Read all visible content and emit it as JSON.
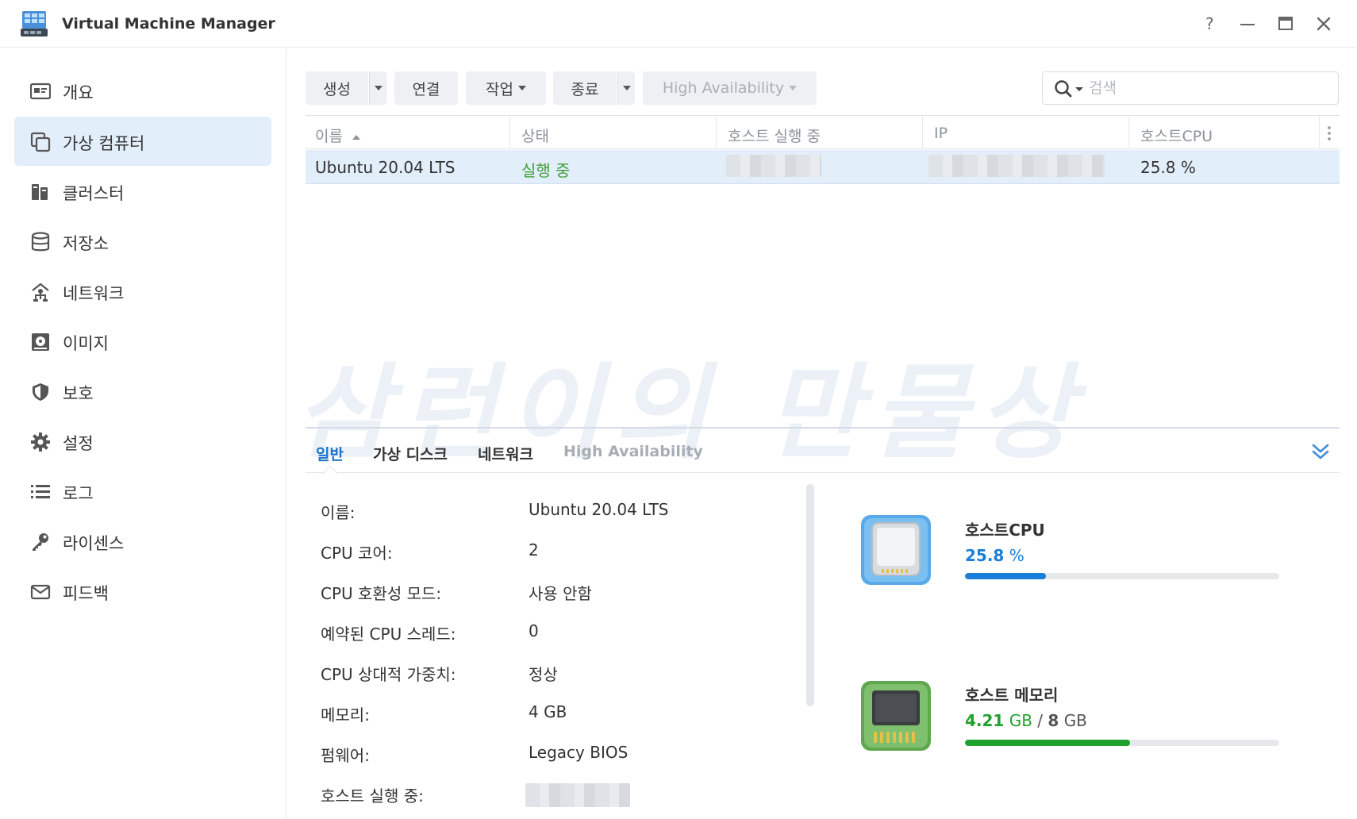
{
  "app": {
    "title": "Virtual Machine Manager",
    "window_controls": [
      "help-icon",
      "minimize-icon",
      "maximize-icon",
      "close-icon"
    ]
  },
  "sidebar": {
    "items": [
      {
        "label": "개요",
        "icon": "overview-icon",
        "active": false
      },
      {
        "label": "가상 컴퓨터",
        "icon": "virtual-machine-icon",
        "active": true
      },
      {
        "label": "클러스터",
        "icon": "cluster-icon",
        "active": false
      },
      {
        "label": "저장소",
        "icon": "storage-icon",
        "active": false
      },
      {
        "label": "네트워크",
        "icon": "network-icon",
        "active": false
      },
      {
        "label": "이미지",
        "icon": "image-icon",
        "active": false
      },
      {
        "label": "보호",
        "icon": "shield-icon",
        "active": false
      },
      {
        "label": "설정",
        "icon": "gear-icon",
        "active": false
      },
      {
        "label": "로그",
        "icon": "list-icon",
        "active": false
      },
      {
        "label": "라이센스",
        "icon": "key-icon",
        "active": false
      },
      {
        "label": "피드백",
        "icon": "mail-icon",
        "active": false
      }
    ]
  },
  "toolbar": {
    "create": "생성",
    "connect": "연결",
    "action": "작업",
    "shutdown": "종료",
    "high_availability": "High Availability"
  },
  "search": {
    "placeholder": "검색"
  },
  "grid": {
    "columns": [
      "이름",
      "상태",
      "호스트 실행 중",
      "IP",
      "호스트CPU"
    ],
    "rows": [
      {
        "name": "Ubuntu 20.04 LTS",
        "status": "실행 중",
        "host": "",
        "ip": "",
        "cpu": "25.8 %"
      }
    ]
  },
  "watermark": "삼런이의 만물상",
  "detail": {
    "tabs": [
      "일반",
      "가상 디스크",
      "네트워크",
      "High Availability"
    ],
    "active_tab": "일반",
    "info": [
      {
        "label": "이름:",
        "value": "Ubuntu 20.04 LTS"
      },
      {
        "label": "CPU 코어:",
        "value": "2"
      },
      {
        "label": "CPU 호환성 모드:",
        "value": "사용 안함"
      },
      {
        "label": "예약된 CPU 스레드:",
        "value": "0"
      },
      {
        "label": "CPU 상대적 가중치:",
        "value": "정상"
      },
      {
        "label": "메모리:",
        "value": "4 GB"
      },
      {
        "label": "펌웨어:",
        "value": "Legacy BIOS"
      },
      {
        "label": "호스트 실행 중:",
        "value": ""
      }
    ],
    "host_cpu": {
      "title": "호스트CPU",
      "value": "25.8",
      "unit": "%",
      "percent": 25.8,
      "color": "#1a7fd8"
    },
    "host_memory": {
      "title": "호스트 메모리",
      "used": "4.21",
      "used_unit": "GB",
      "separator": "/",
      "total": "8",
      "total_unit": "GB",
      "fraction": 0.526,
      "color": "#1fa22b"
    }
  }
}
